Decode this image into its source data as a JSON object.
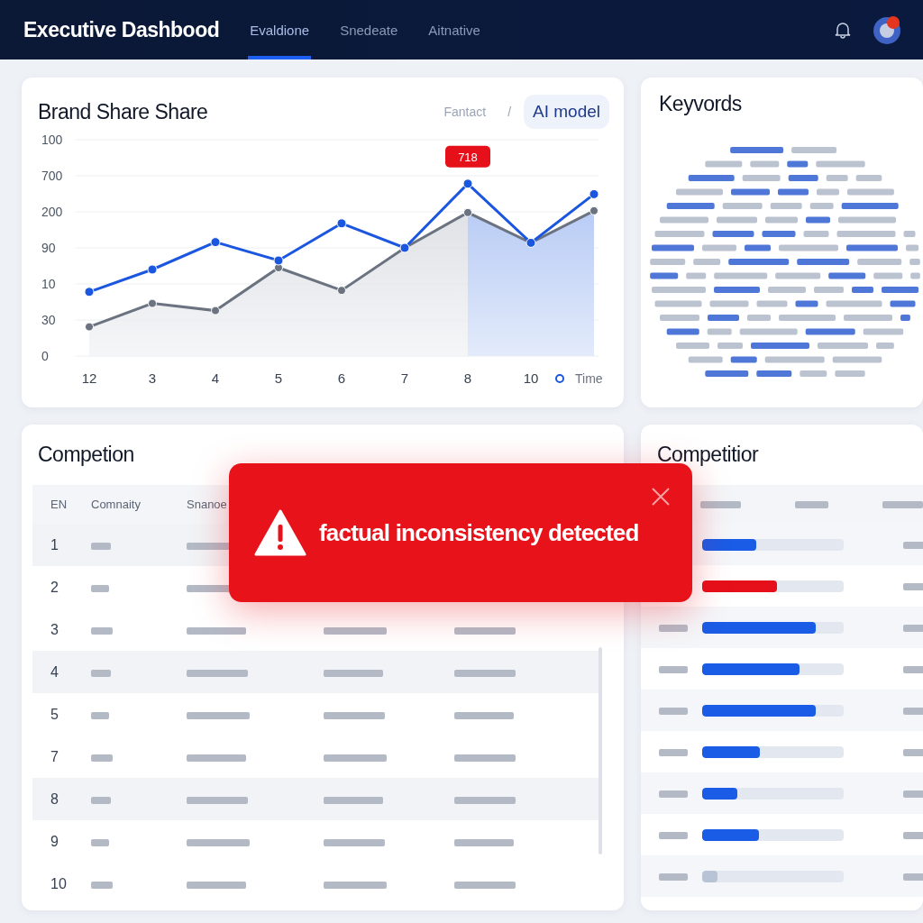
{
  "header": {
    "title": "Executive Dashbood",
    "tabs": [
      {
        "label": "Evaldione",
        "selected": true
      },
      {
        "label": "Snedeate",
        "selected": false
      },
      {
        "label": "Aitnative",
        "selected": false
      }
    ]
  },
  "brand_share": {
    "title": "Brand Share Share",
    "separator": "/",
    "toggle": [
      {
        "label": "Fantact",
        "selected": false
      },
      {
        "label": "AI model",
        "selected": true
      }
    ],
    "y_axis_labels": [
      "100",
      "700",
      "200",
      "90",
      "10",
      "30",
      "0"
    ],
    "x_axis_labels": [
      "12",
      "3",
      "4",
      "5",
      "6",
      "7",
      "8",
      "10"
    ],
    "badge": "718",
    "legend": "Time"
  },
  "keywords": {
    "title": "Keyvords"
  },
  "competition": {
    "title": "Competion",
    "columns": [
      "EN",
      "Comnaity",
      "Snanoe"
    ],
    "rows": [
      {
        "rank": "1"
      },
      {
        "rank": "2"
      },
      {
        "rank": "3"
      },
      {
        "rank": "4"
      },
      {
        "rank": "5"
      },
      {
        "rank": "7"
      },
      {
        "rank": "8"
      },
      {
        "rank": "9"
      },
      {
        "rank": "10"
      }
    ]
  },
  "competitor": {
    "title": "Competitior",
    "rows": [
      {
        "level": 0.38,
        "color": "#1a5ce6"
      },
      {
        "level": 0.53,
        "color": "#e5101a"
      },
      {
        "level": 0.8,
        "color": "#1a5ce6"
      },
      {
        "level": 0.69,
        "color": "#1a5ce6"
      },
      {
        "level": 0.8,
        "color": "#1a5ce6"
      },
      {
        "level": 0.41,
        "color": "#1a5ce6"
      },
      {
        "level": 0.25,
        "color": "#1a5ce6"
      },
      {
        "level": 0.4,
        "color": "#1a5ce6"
      },
      {
        "level": 0.11,
        "color": "#b8c4d6"
      }
    ]
  },
  "alert": {
    "message": "factual inconsistency detected"
  }
}
